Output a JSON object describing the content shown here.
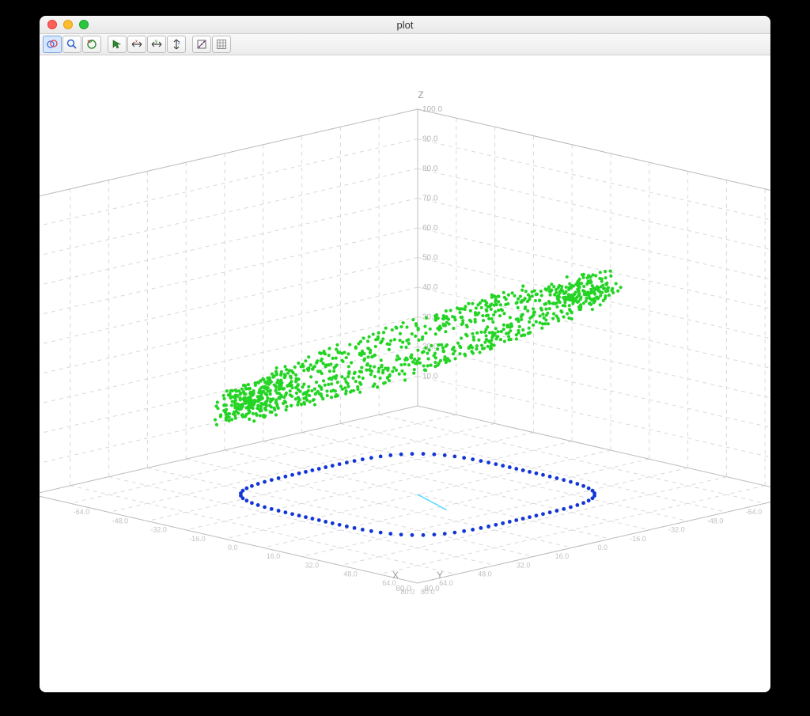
{
  "window": {
    "title": "plot"
  },
  "toolbar": {
    "buttons": [
      {
        "name": "rotate3d-icon",
        "active": true
      },
      {
        "name": "zoom-icon",
        "active": false
      },
      {
        "name": "reset-view-icon",
        "active": false
      },
      {
        "name": "sep",
        "active": false
      },
      {
        "name": "select-icon",
        "active": false
      },
      {
        "name": "pan-x-icon",
        "active": false
      },
      {
        "name": "pan-y-icon",
        "active": false
      },
      {
        "name": "pan-z-icon",
        "active": false
      },
      {
        "name": "sep",
        "active": false
      },
      {
        "name": "toggle-axes-icon",
        "active": false
      },
      {
        "name": "grid-icon",
        "active": false
      }
    ]
  },
  "chart_data": {
    "type": "scatter",
    "projection": "3d",
    "axes": {
      "x": {
        "label": "X",
        "range": [
          -80,
          80
        ],
        "ticks": [
          -64.0,
          -48.0,
          -32.0,
          -16.0,
          0.0,
          16.0,
          32.0,
          48.0,
          64.0,
          80.0
        ]
      },
      "y": {
        "label": "Y",
        "range": [
          -80,
          80
        ],
        "ticks": [
          -64.0,
          -48.0,
          -32.0,
          -16.0,
          0.0,
          16.0,
          32.0,
          48.0,
          64.0,
          80.0
        ]
      },
      "z": {
        "label": "Z",
        "range": [
          0,
          100
        ],
        "ticks": [
          10.0,
          20.0,
          30.0,
          40.0,
          50.0,
          60.0,
          70.0,
          80.0,
          90.0,
          100.0
        ]
      }
    },
    "series": [
      {
        "name": "green-scatter",
        "color": "#27d527",
        "marker": "dot",
        "description": "noisy tilted ring of ~1000 points, center approx (0,0,50), radius ~55 in XY, tilted so z rises with y from ~25 to ~80"
      },
      {
        "name": "blue-ring",
        "color": "#1236d6",
        "marker": "dot",
        "description": "smooth rounded-square ring on z=0 plane, ~100 points, half-extent ~45, corner radius ~18"
      },
      {
        "name": "cyan-normal-line",
        "color": "#33d2ff",
        "type": "line",
        "points": [
          [
            0,
            0,
            0
          ],
          [
            8,
            20,
            0
          ]
        ],
        "description": "short cyan line segment on floor from origin"
      }
    ]
  }
}
